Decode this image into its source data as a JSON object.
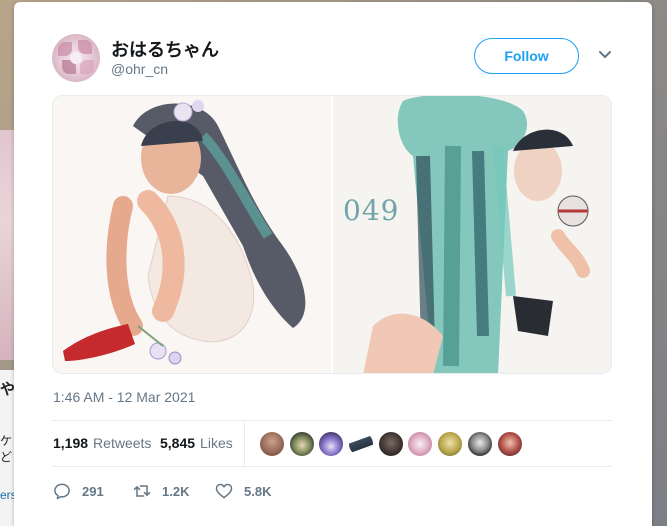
{
  "background": {
    "edge_letter": "や",
    "edge_text_1": "ケ",
    "edge_text_2": "ど",
    "edge_link": "ers"
  },
  "tweet": {
    "author": {
      "display_name": "おはるちゃん",
      "handle": "@ohr_cn"
    },
    "follow_label": "Follow",
    "media": {
      "artwork_number": "049"
    },
    "timestamp": "1:46 AM - 12 Mar 2021",
    "stats": {
      "retweets_count": "1,198",
      "retweets_label": "Retweets",
      "likes_count": "5,845",
      "likes_label": "Likes"
    },
    "liker_avatars": [
      {
        "icon": "avatar"
      },
      {
        "icon": "avatar"
      },
      {
        "icon": "avatar"
      },
      {
        "icon": "avatar"
      },
      {
        "icon": "avatar"
      },
      {
        "icon": "avatar"
      },
      {
        "icon": "avatar"
      },
      {
        "icon": "avatar"
      },
      {
        "icon": "avatar"
      }
    ],
    "actions": {
      "reply_count": "291",
      "retweet_count": "1.2K",
      "like_count": "5.8K"
    }
  },
  "colors": {
    "accent": "#1da1f2",
    "secondary_text": "#657786",
    "primary_text": "#14171a"
  }
}
